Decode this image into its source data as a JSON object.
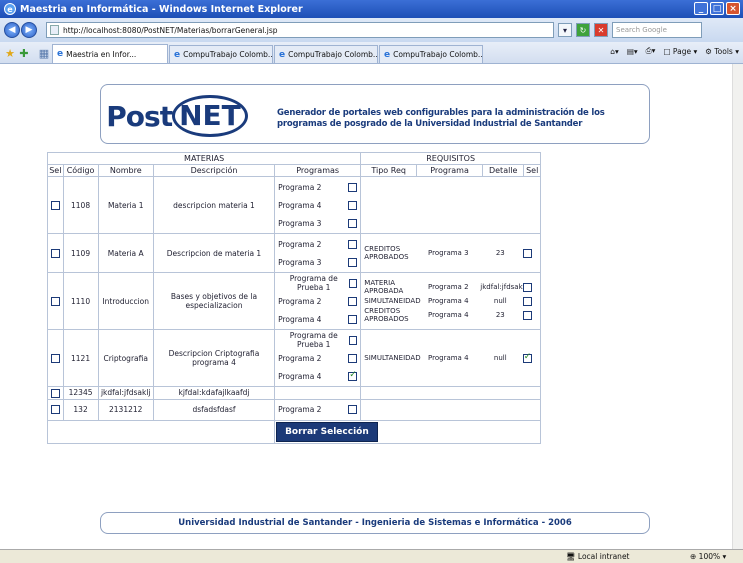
{
  "window": {
    "title": "Maestria en Informática - Windows Internet Explorer"
  },
  "address": {
    "url": "http://localhost:8080/PostNET/Materias/borrarGeneral.jsp",
    "search_placeholder": "Search Google"
  },
  "tabs": [
    "Maestria en Infor...",
    "CompuTrabajo Colomb...",
    "CompuTrabajo Colomb...",
    "CompuTrabajo Colomb..."
  ],
  "toolbar": {
    "page": "Page",
    "tools": "Tools"
  },
  "header": {
    "logo_post": "Post",
    "logo_net": "NET",
    "tagline": "Generador de portales web configurables para la administración de los programas de posgrado de la Universidad Industrial de Santander"
  },
  "table": {
    "group_materias": "MATERIAS",
    "group_requisitos": "REQUISITOS",
    "col_sel": "Sel",
    "col_codigo": "Código",
    "col_nombre": "Nombre",
    "col_descripcion": "Descripción",
    "col_programas": "Programas",
    "col_tipo": "Tipo Req",
    "col_programa": "Programa",
    "col_detalle": "Detalle",
    "col_sel2": "Sel",
    "rows": [
      {
        "codigo": "1108",
        "nombre": "Materia 1",
        "descripcion": "descripcion materia 1",
        "programas": [
          "Programa 2",
          "Programa 4",
          "Programa 3"
        ],
        "programas_checked": [
          false,
          false,
          false
        ],
        "requisitos": []
      },
      {
        "codigo": "1109",
        "nombre": "Materia A",
        "descripcion": "Descripcion de materia 1",
        "programas": [
          "Programa 2",
          "Programa 3"
        ],
        "programas_checked": [
          false,
          false
        ],
        "requisitos": [
          {
            "tipo": "CREDITOS APROBADOS",
            "programa": "Programa 3",
            "detalle": "23",
            "checked": false
          }
        ]
      },
      {
        "codigo": "1110",
        "nombre": "Introduccion",
        "descripcion": "Bases y objetivos de la especializacion",
        "programas": [
          "Programa de Prueba 1",
          "Programa 2",
          "Programa 4"
        ],
        "programas_checked": [
          false,
          false,
          false
        ],
        "requisitos": [
          {
            "tipo": "MATERIA APROBADA",
            "programa": "Programa 2",
            "detalle": "jkdfal:jfdsaklj",
            "checked": false
          },
          {
            "tipo": "SIMULTANEIDAD",
            "programa": "Programa 4",
            "detalle": "null",
            "checked": false
          },
          {
            "tipo": "CREDITOS APROBADOS",
            "programa": "Programa 4",
            "detalle": "23",
            "checked": false
          }
        ]
      },
      {
        "codigo": "1121",
        "nombre": "Criptografia",
        "descripcion": "Descripcion Criptografia programa 4",
        "programas": [
          "Programa de Prueba 1",
          "Programa 2",
          "Programa 4"
        ],
        "programas_checked": [
          false,
          false,
          true
        ],
        "requisitos": [
          {
            "tipo": "SIMULTANEIDAD",
            "programa": "Programa 4",
            "detalle": "null",
            "checked": true
          }
        ]
      },
      {
        "codigo": "12345",
        "nombre": "jkdfal:jfdsaklj",
        "descripcion": "kjfdal:kdafajlkaafdj",
        "programas": [],
        "programas_checked": [],
        "requisitos": []
      },
      {
        "codigo": "132",
        "nombre": "2131212",
        "descripcion": "dsfadsfdasf",
        "programas": [
          "Programa 2"
        ],
        "programas_checked": [
          false
        ],
        "requisitos": []
      }
    ],
    "delete_label": "Borrar Selección"
  },
  "footer": {
    "text": "Universidad Industrial de Santander - Ingenieria de Sistemas e Informática - 2006"
  },
  "status": {
    "zone": "Local intranet",
    "zoom": "100%"
  }
}
